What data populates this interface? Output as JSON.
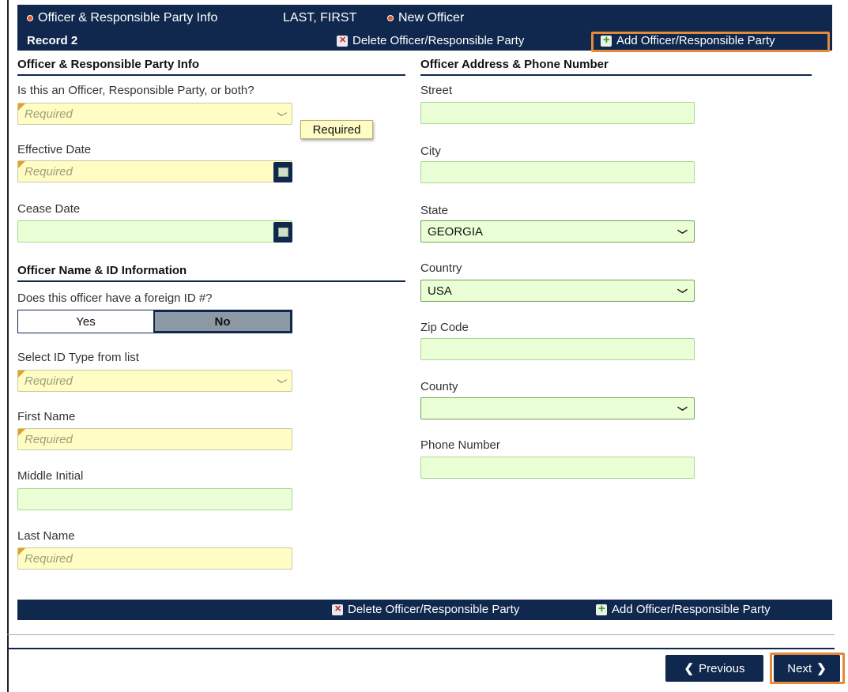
{
  "header": {
    "crumb1": "Officer & Responsible Party Info",
    "crumb_name": "LAST, FIRST",
    "crumb2": "New Officer",
    "record": "Record 2",
    "delete_label": "Delete Officer/Responsible Party",
    "add_label": "Add Officer/Responsible Party"
  },
  "left": {
    "section1": "Officer & Responsible Party Info",
    "type_label": "Is this an Officer, Responsible Party, or both?",
    "type_placeholder": "Required",
    "tooltip": "Required",
    "effective_label": "Effective Date",
    "effective_placeholder": "Required",
    "cease_label": "Cease Date",
    "cease_value": "",
    "section2": "Officer Name & ID Information",
    "foreign_label": "Does this officer have a foreign ID #?",
    "yes": "Yes",
    "no": "No",
    "idtype_label": "Select ID Type from list",
    "idtype_placeholder": "Required",
    "first_label": "First Name",
    "first_placeholder": "Required",
    "middle_label": "Middle Initial",
    "middle_value": "",
    "last_label": "Last Name",
    "last_placeholder": "Required"
  },
  "right": {
    "section": "Officer Address & Phone Number",
    "street_label": "Street",
    "city_label": "City",
    "state_label": "State",
    "state_value": "GEORGIA",
    "country_label": "Country",
    "country_value": "USA",
    "zip_label": "Zip Code",
    "county_label": "County",
    "county_value": "",
    "phone_label": "Phone Number"
  },
  "footer": {
    "delete_label": "Delete Officer/Responsible Party",
    "add_label": "Add Officer/Responsible Party",
    "previous": "Previous",
    "next": "Next"
  },
  "colors": {
    "navy": "#10284e",
    "required_bg": "#fffcc4",
    "optional_bg": "#eaffd6",
    "highlight": "#e58a3a"
  }
}
